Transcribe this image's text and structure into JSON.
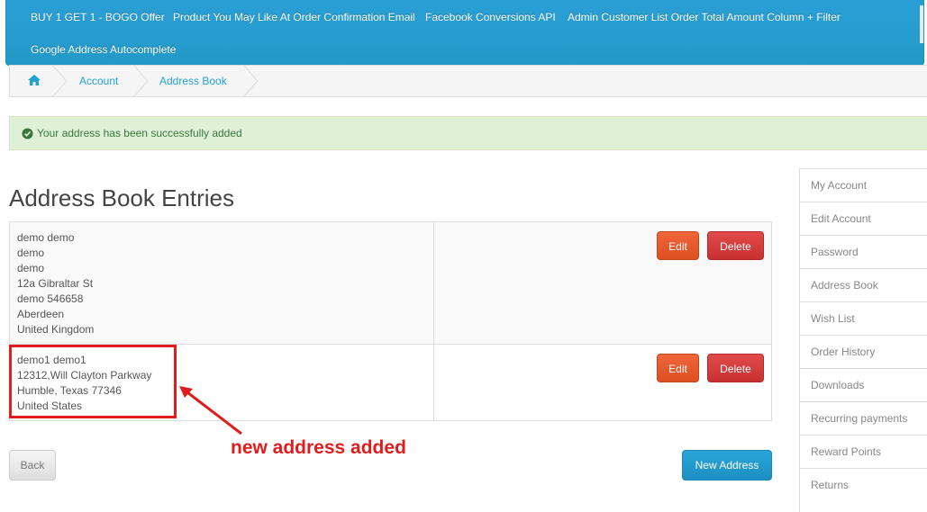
{
  "menu": {
    "items": [
      "BUY 1 GET 1 - BOGO Offer",
      "Product You May Like At Order Confirmation Email",
      "Facebook Conversions API",
      "Admin Customer List Order Total Amount Column + Filter",
      "Google Address Autocomplete"
    ]
  },
  "breadcrumb": {
    "home_icon": "home-icon",
    "items": [
      "Account",
      "Address Book"
    ]
  },
  "alert": {
    "icon": "check-circle-icon",
    "text": "Your address has been successfully added",
    "color": "#3c763d"
  },
  "page": {
    "title": "Address Book Entries"
  },
  "addresses": [
    {
      "lines": [
        "demo demo",
        "demo",
        "demo",
        "12a Gibraltar St",
        "demo 546658",
        "Aberdeen",
        "United Kingdom"
      ],
      "edit_label": "Edit",
      "delete_label": "Delete"
    },
    {
      "lines": [
        "demo1 demo1",
        "12312,Will Clayton Parkway",
        "Humble, Texas 77346",
        "United States"
      ],
      "edit_label": "Edit",
      "delete_label": "Delete"
    }
  ],
  "annotation": {
    "text": "new address added",
    "color": "#e11c1c"
  },
  "actions": {
    "back_label": "Back",
    "new_address_label": "New Address"
  },
  "sidebar": {
    "items": [
      "My Account",
      "Edit Account",
      "Password",
      "Address Book",
      "Wish List",
      "Order History",
      "Downloads",
      "Recurring payments",
      "Reward Points",
      "Returns"
    ]
  },
  "colors": {
    "menu_bg": "#229ac8",
    "link": "#23a1d1",
    "edit_btn": "#dc4f21",
    "delete_btn": "#c7302f",
    "primary_btn": "#1c8fc2"
  }
}
